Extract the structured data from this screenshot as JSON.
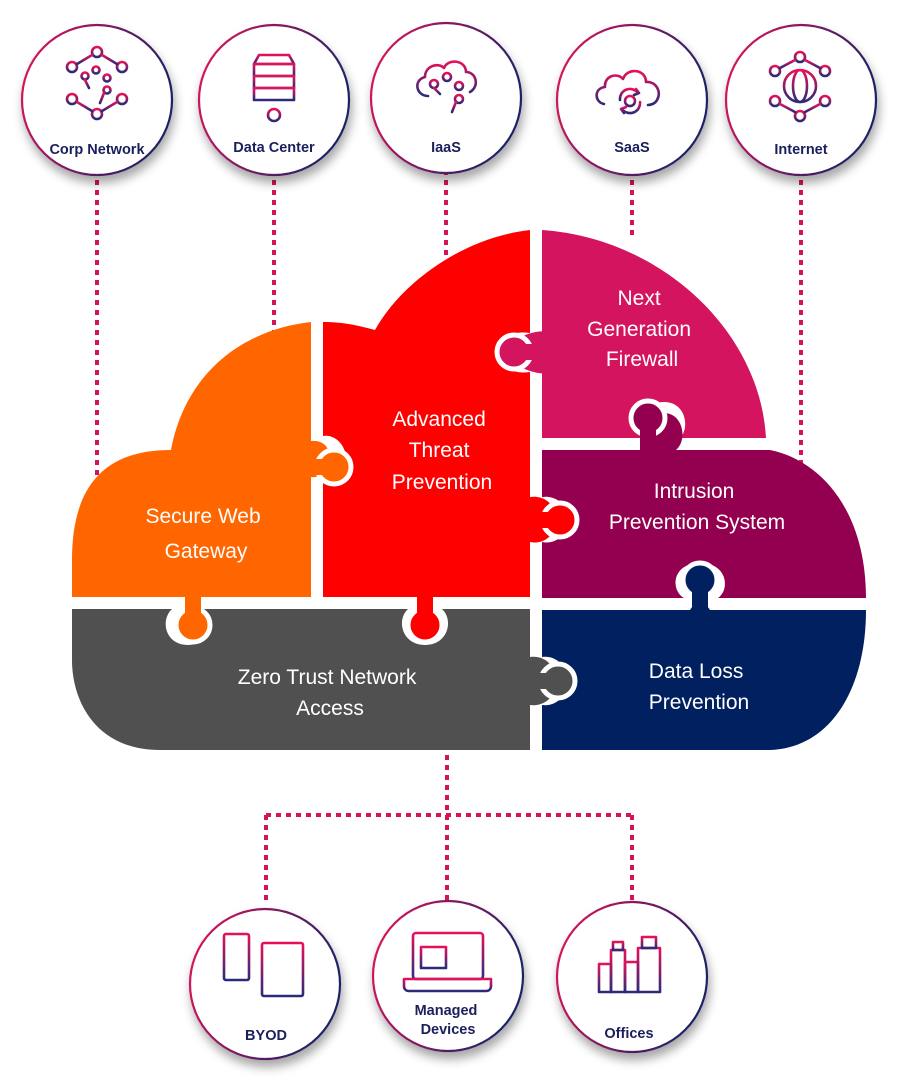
{
  "colors": {
    "connector": "#d4145a",
    "label_text": "#1b1f5c",
    "icon_gradient": [
      "#e8105a",
      "#2b2a7a"
    ],
    "secure_web_gateway": "#ff6600",
    "advanced_threat_prevention": "#ff0000",
    "next_generation_firewall": "#d4145f",
    "intrusion_prevention_system": "#930050",
    "zero_trust_network_access": "#505050",
    "data_loss_prevention": "#00205f"
  },
  "top_nodes": [
    {
      "label": "Corp Network",
      "icon": "network-hexagon-icon"
    },
    {
      "label": "Data Center",
      "icon": "server-rack-icon"
    },
    {
      "label": "IaaS",
      "icon": "cloud-circuit-icon"
    },
    {
      "label": "SaaS",
      "icon": "cloud-sync-icon"
    },
    {
      "label": "Internet",
      "icon": "globe-network-icon"
    }
  ],
  "cloud_pieces": {
    "secure_web_gateway": [
      "Secure Web",
      "Gateway"
    ],
    "advanced_threat_prevention": [
      "Advanced",
      "Threat",
      "Prevention"
    ],
    "next_generation_firewall": [
      "Next",
      "Generation",
      "Firewall"
    ],
    "intrusion_prevention_system": [
      "Intrusion",
      "Prevention  System"
    ],
    "zero_trust_network_access": [
      "Zero Trust Network",
      "Access"
    ],
    "data_loss_prevention": [
      "Data Loss",
      "Prevention"
    ]
  },
  "bottom_nodes": [
    {
      "label": [
        "BYOD"
      ],
      "icon": "phone-tablet-icon"
    },
    {
      "label": [
        "Managed",
        "Devices"
      ],
      "icon": "laptop-icon"
    },
    {
      "label": [
        "Offices"
      ],
      "icon": "office-buildings-icon"
    }
  ]
}
